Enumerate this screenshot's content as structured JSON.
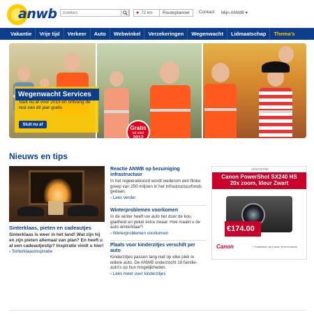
{
  "header": {
    "logo_text": "anwb",
    "search_placeholder": "zoeken",
    "route_km": "72 km",
    "route_label": "Routeplanner",
    "contact": "Contact",
    "mijn": "Mijn ANWB ▾"
  },
  "nav": {
    "items": [
      "Vakantie",
      "Vrije tijd",
      "Verkeer",
      "Auto",
      "Webwinkel",
      "Verzekeringen",
      "Wegenwacht",
      "Lidmaatschap",
      "Thema's"
    ]
  },
  "hero": {
    "title": "Wegenwacht Services",
    "text": "Sluit nu af voor 2013 en ontvang de rest van dit jaar gratis",
    "button": "Sluit nu af",
    "badge_line1": "Gratis",
    "badge_line2": "tot eind",
    "badge_line3": "2012"
  },
  "news": {
    "heading": "Nieuws en tips",
    "feature": {
      "title": "Sinterklaas, pieten en cadeautjes",
      "text": "Sinterklaas is weer in het land! Wat zijn hij en zijn pieten allemaal van plan? En heeft u al een cadeautjestip? Inspiratie vindt u hier!",
      "link": "Sinterklaasinspiratie"
    },
    "items": [
      {
        "title": "Reactie ANWB op bezuiniging infrastructuur",
        "text": "In het regeerakkoord wordt wederom een flinke greep van 250 miljoen in het Infrastructuurfonds gedaan.",
        "link": "Lees verder"
      },
      {
        "title": "Winterproblemen voorkomen",
        "text": "In de winter heeft uw auto het door de kou, gladheid en pekel extra zwaar. Hoe maakt u de auto winterklaar?",
        "link": "Winterproblemen voorkomen"
      },
      {
        "title": "Plaats voor kinderzitjes verschilt per auto",
        "text": "Kinderzitjes passen lang niet op elke plek in iedere auto. De ANWB onderzocht 18 familie-auto's op hun mogelijkheden.",
        "link": "Lees meer over kinderzitjes"
      }
    ]
  },
  "ad": {
    "label": "advertentie",
    "headline": "Canon PowerShot SX240 HS",
    "subline": "20x zoom, kleur Zwart",
    "price": "€174.00",
    "brand": "Canon",
    "note": "* Cashback via Canon of leverancier"
  },
  "colors": {
    "brand_blue": "#0c3d8a",
    "brand_yellow": "#ffcc00",
    "badge_red": "#e2001a"
  }
}
